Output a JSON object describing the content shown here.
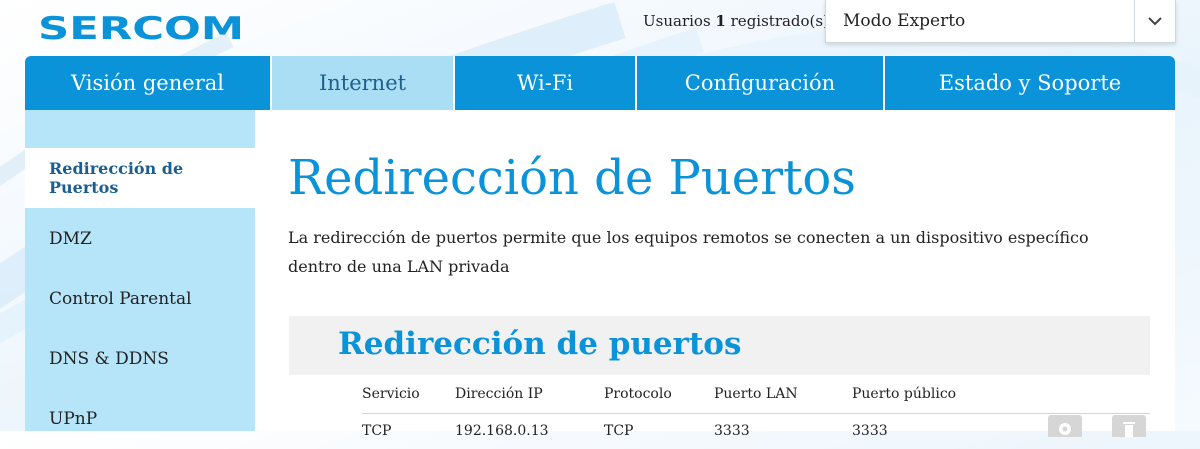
{
  "brand": {
    "logo_text": "SERCOM",
    "color": "#0a93d9"
  },
  "header": {
    "users_prefix": "Usuarios",
    "users_count": "1",
    "users_suffix": "registrado(s)",
    "mode_value": "Modo Experto",
    "mode_icon": "chevron-down-icon"
  },
  "nav": {
    "tabs": [
      {
        "label": "Visión general",
        "active": false
      },
      {
        "label": "Internet",
        "active": true
      },
      {
        "label": "Wi-Fi",
        "active": false
      },
      {
        "label": "Configuración",
        "active": false
      },
      {
        "label": "Estado y Soporte",
        "active": false
      }
    ]
  },
  "sidebar": {
    "items": [
      {
        "label": "Redirección de Puertos",
        "active": true
      },
      {
        "label": "DMZ",
        "active": false
      },
      {
        "label": "Control Parental",
        "active": false
      },
      {
        "label": "DNS & DDNS",
        "active": false
      },
      {
        "label": "UPnP",
        "active": false
      }
    ]
  },
  "main": {
    "title": "Redirección de Puertos",
    "description": "La redirección de puertos permite que los equipos remotos se conecten a un dispositivo específico dentro de una LAN privada",
    "section_title": "Redirección de puertos",
    "columns": [
      "Servicio",
      "Dirección IP",
      "Protocolo",
      "Puerto LAN",
      "Puerto público"
    ],
    "row_partial": [
      "TCP",
      "192.168.0.13",
      "TCP",
      "3333",
      "3333"
    ],
    "row_actions": [
      {
        "icon": "gear-icon"
      },
      {
        "icon": "trash-icon"
      }
    ]
  }
}
